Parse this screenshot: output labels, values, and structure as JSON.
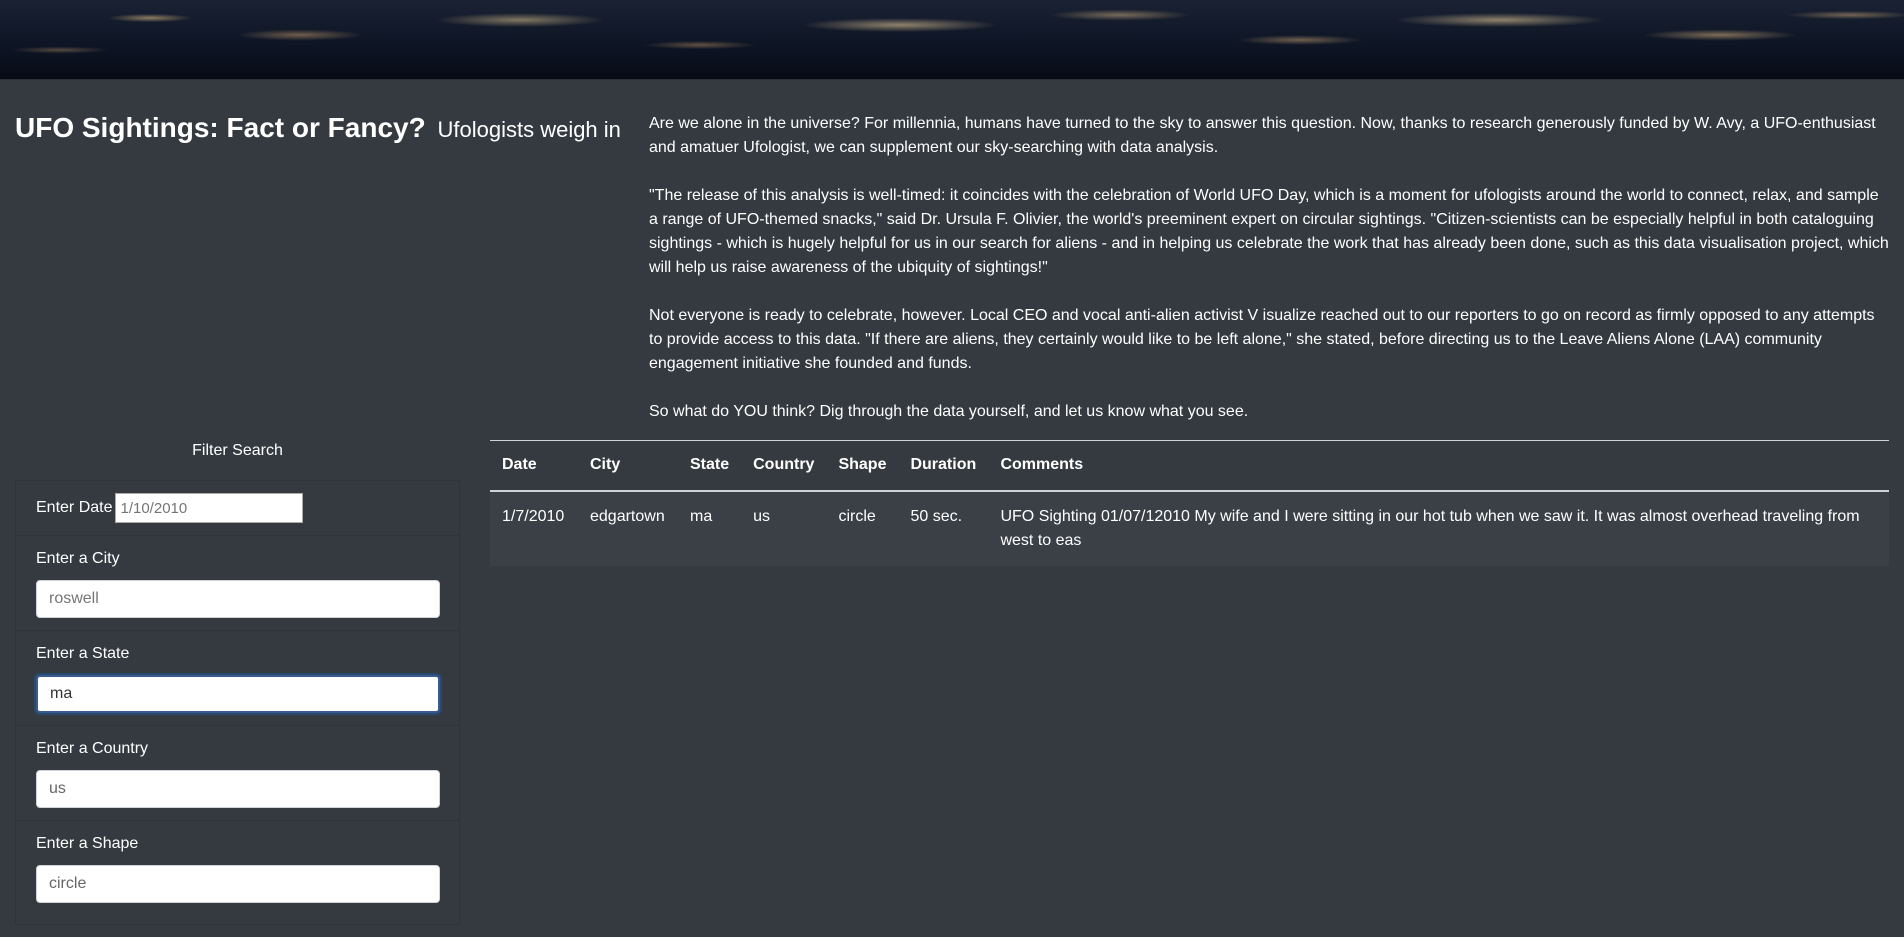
{
  "header": {
    "title": "UFO Sightings: Fact or Fancy?",
    "subtitle": "Ufologists weigh in"
  },
  "article": {
    "paragraphs": [
      "Are we alone in the universe? For millennia, humans have turned to the sky to answer this question. Now, thanks to research generously funded by W. Avy, a UFO-enthusiast and amatuer Ufologist, we can supplement our sky-searching with data analysis.",
      "\"The release of this analysis is well-timed: it coincides with the celebration of World UFO Day, which is a moment for ufologists around the world to connect, relax, and sample a range of UFO-themed snacks,\" said Dr. Ursula F. Olivier, the world's preeminent expert on circular sightings. \"Citizen-scientists can be especially helpful in both cataloguing sightings - which is hugely helpful for us in our search for aliens - and in helping us celebrate the work that has already been done, such as this data visualisation project, which will help us raise awareness of the ubiquity of sightings!\"",
      "Not everyone is ready to celebrate, however. Local CEO and vocal anti-alien activist V isualize reached out to our reporters to go on record as firmly opposed to any attempts to provide access to this data. \"If there are aliens, they certainly would like to be left alone,\" she stated, before directing us to the Leave Aliens Alone (LAA) community engagement initiative she founded and funds.",
      "So what do YOU think? Dig through the data yourself, and let us know what you see."
    ]
  },
  "filters": {
    "heading": "Filter Search",
    "date": {
      "label": "Enter Date",
      "placeholder": "1/10/2010",
      "value": ""
    },
    "city": {
      "label": "Enter a City",
      "placeholder": "roswell",
      "value": ""
    },
    "state": {
      "label": "Enter a State",
      "placeholder": "",
      "value": "ma"
    },
    "country": {
      "label": "Enter a Country",
      "placeholder": "",
      "value": "us"
    },
    "shape": {
      "label": "Enter a Shape",
      "placeholder": "",
      "value": "circle"
    }
  },
  "table": {
    "columns": [
      "Date",
      "City",
      "State",
      "Country",
      "Shape",
      "Duration",
      "Comments"
    ],
    "rows": [
      [
        "1/7/2010",
        "edgartown",
        "ma",
        "us",
        "circle",
        "50 sec.",
        "UFO Sighting 01/07/12010 My wife and I were sitting in our hot tub when we saw it. It was almost overhead traveling from west to eas"
      ]
    ]
  }
}
